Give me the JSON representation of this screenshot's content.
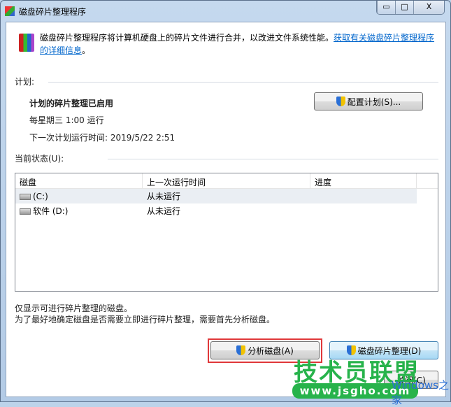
{
  "window": {
    "title": "磁盘碎片整理程序",
    "minimize": "▭",
    "maximize": "□",
    "close": "X"
  },
  "intro": {
    "text": "磁盘碎片整理程序将计算机硬盘上的碎片文件进行合并，以改进文件系统性能。",
    "link": "获取有关磁盘碎片整理程序的详细信息",
    "end": "。"
  },
  "schedule": {
    "label": "计划:",
    "status": "计划的碎片整理已启用",
    "frequency": "每星期三  1:00 运行",
    "next_run": "下一次计划运行时间: 2019/5/22 2:51",
    "configure_button": "配置计划(S)..."
  },
  "current": {
    "label": "当前状态(U):",
    "columns": [
      "磁盘",
      "上一次运行时间",
      "进度"
    ],
    "rows": [
      {
        "disk": "(C:)",
        "last_run": "从未运行",
        "progress": ""
      },
      {
        "disk": "软件 (D:)",
        "last_run": "从未运行",
        "progress": ""
      }
    ]
  },
  "notes": [
    "仅显示可进行碎片整理的磁盘。",
    "为了最好地确定磁盘是否需要立即进行碎片整理，需要首先分析磁盘。"
  ],
  "buttons": {
    "analyze": "分析磁盘(A)",
    "defragment": "磁盘碎片整理(D)",
    "close": "关闭(C)"
  },
  "watermark": {
    "title": "技术员联盟",
    "url": "www.jsgho.com",
    "sub": "Windows之家"
  },
  "colors": {
    "highlight": "#e0383a",
    "link": "#0066cc"
  }
}
